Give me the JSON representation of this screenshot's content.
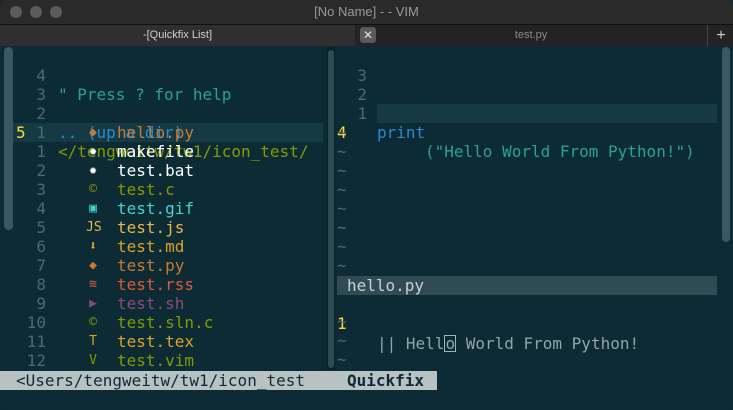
{
  "window": {
    "title": "[No Name] - - VIM"
  },
  "tabs": {
    "left_label": "-[Quickfix List]",
    "close_glyph": "✕",
    "right_label": "test.py",
    "new_glyph": "+"
  },
  "left_pane": {
    "lines": [
      {
        "num": "4",
        "text": "\" Press ? for help",
        "color": "#2aa198"
      },
      {
        "num": "3",
        "text": "",
        "color": "#2aa198"
      },
      {
        "num": "2",
        "text": ".. (up a dir)",
        "color": "#268bd2"
      },
      {
        "num": "1",
        "text": "</tengweitw/tw1/icon_test/",
        "color": "#859900"
      }
    ],
    "current_line_num": "5",
    "files": [
      {
        "num": "",
        "icon": "◆",
        "icon_name": "python-icon",
        "name": "hello.py",
        "color": "#cb7a32",
        "icon_color": "#cb7a32"
      },
      {
        "num": "1",
        "icon": "✹",
        "icon_name": "gear-icon",
        "name": "makefile",
        "color": "#ffffff",
        "icon_color": "#ffffff"
      },
      {
        "num": "2",
        "icon": "✹",
        "icon_name": "gear-icon",
        "name": "test.bat",
        "color": "#ffffff",
        "icon_color": "#ffffff"
      },
      {
        "num": "3",
        "icon": "©",
        "icon_name": "c-icon",
        "name": "test.c",
        "color": "#859900",
        "icon_color": "#859900"
      },
      {
        "num": "4",
        "icon": "▣",
        "icon_name": "image-icon",
        "name": "test.gif",
        "color": "#40d8c8",
        "icon_color": "#40d8c8"
      },
      {
        "num": "5",
        "icon": "JS",
        "icon_name": "javascript-icon",
        "name": "test.js",
        "color": "#e8b64a",
        "icon_color": "#e8b64a"
      },
      {
        "num": "6",
        "icon": "⬇",
        "icon_name": "markdown-icon",
        "name": "test.md",
        "color": "#d9a32a",
        "icon_color": "#d9a32a"
      },
      {
        "num": "7",
        "icon": "◆",
        "icon_name": "python-icon",
        "name": "test.py",
        "color": "#cb7a32",
        "icon_color": "#cb7a32"
      },
      {
        "num": "8",
        "icon": "≋",
        "icon_name": "rss-icon",
        "name": "test.rss",
        "color": "#e05a3a",
        "icon_color": "#e05a3a"
      },
      {
        "num": "9",
        "icon": "▶",
        "icon_name": "shell-icon",
        "name": "test.sh",
        "color": "#8a4a7a",
        "icon_color": "#8a4a7a"
      },
      {
        "num": "10",
        "icon": "©",
        "icon_name": "csharp-icon",
        "name": "test.sln.c",
        "color": "#859900",
        "icon_color": "#859900"
      },
      {
        "num": "11",
        "icon": "T",
        "icon_name": "tex-icon",
        "name": "test.tex",
        "color": "#d9a32a",
        "icon_color": "#d9a32a"
      },
      {
        "num": "12",
        "icon": "V",
        "icon_name": "vim-icon",
        "name": "test.vim",
        "color": "#859900",
        "icon_color": "#859900"
      }
    ]
  },
  "right_pane": {
    "lines": [
      {
        "num": "3",
        "text": ""
      },
      {
        "num": "2",
        "text": ""
      }
    ],
    "code_line": {
      "num": "1",
      "prefix": "print",
      "rest": "(\"Hello World From Python!\")"
    },
    "current_line_num": "4",
    "tilde": "~",
    "quickfix_title": "hello.py",
    "quickfix_line": {
      "num": "1",
      "pre": "|| Hell",
      "cursor": "o",
      "post": " World From Python!"
    }
  },
  "status": {
    "left": "<Users/tengweitw/tw1/icon_test",
    "right": "Quickfix"
  },
  "colors": {
    "background": "#0d2b34",
    "line_number": "#4a6a73",
    "current_line_number": "#ffd83a",
    "string": "#2aa198",
    "keyword": "#268bd2"
  }
}
